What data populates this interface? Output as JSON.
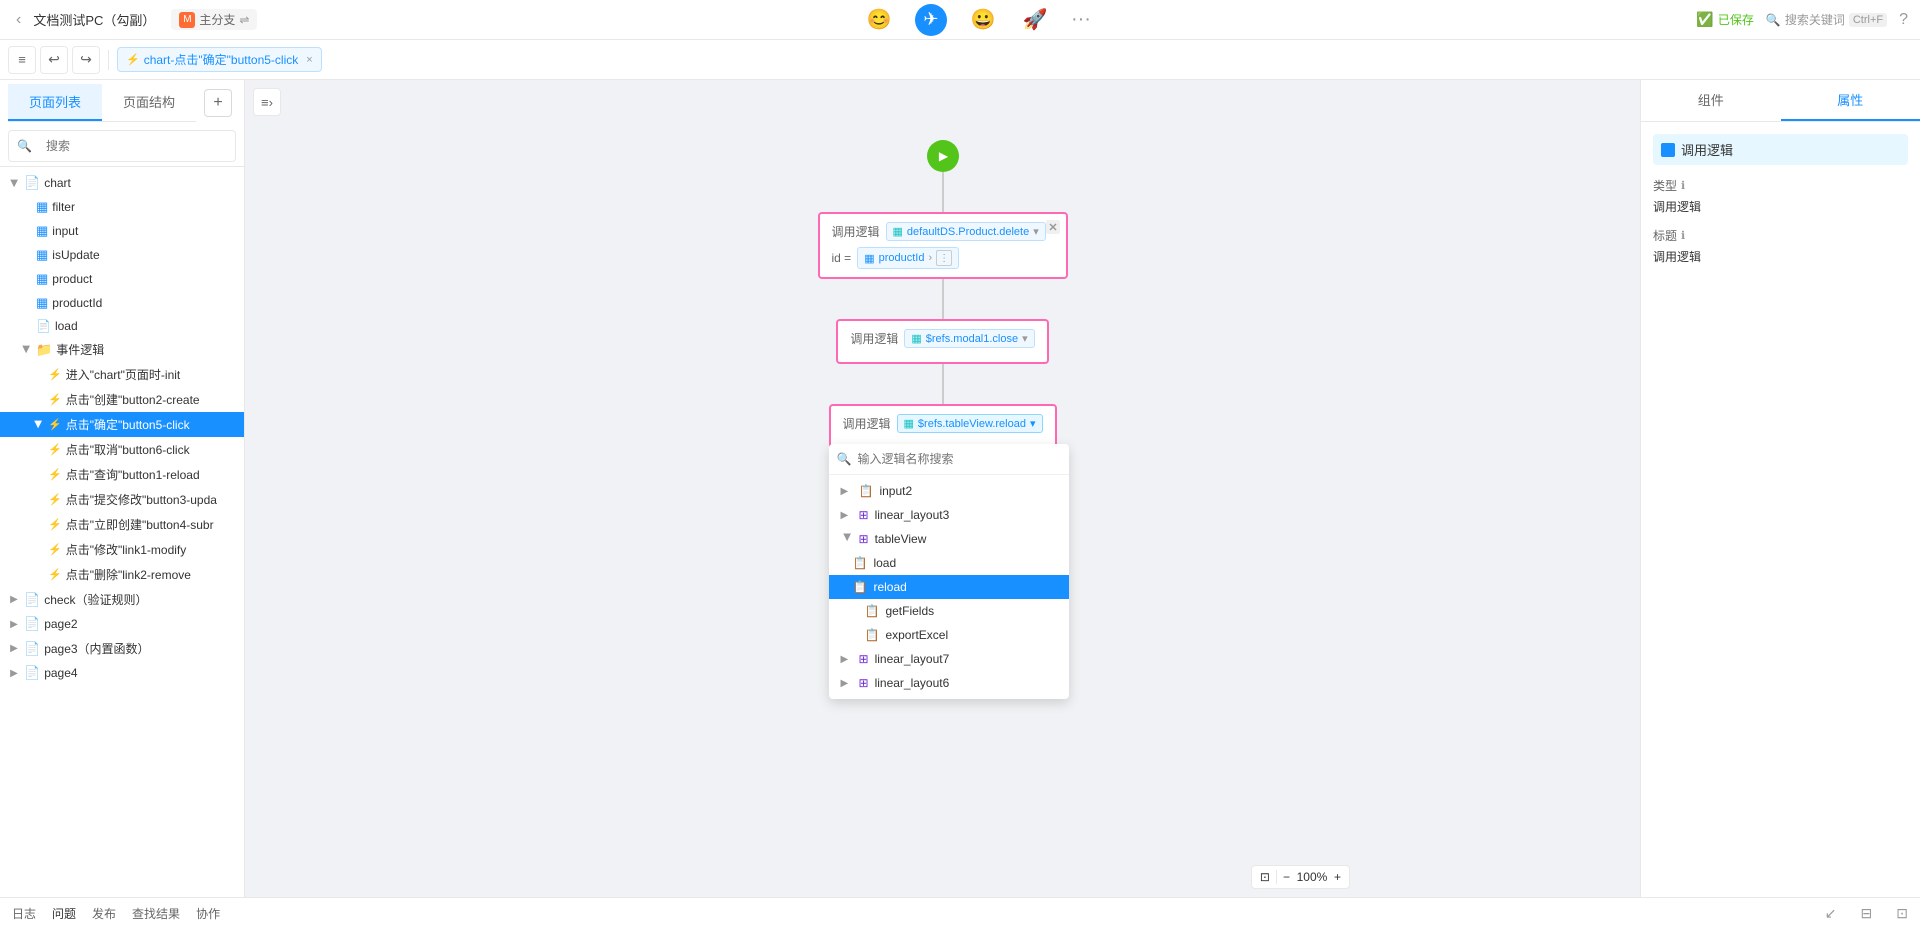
{
  "window": {
    "title": "文档测试PC（勾副）"
  },
  "topbar": {
    "title": "文档测试PC（勾副）",
    "branch_icon": "M",
    "branch_name": "主分支",
    "branch_sync": "⇌",
    "icon1": "😊",
    "icon2": "✈",
    "icon3": "😀",
    "icon4": "🚀",
    "more": "···",
    "saved_icon": "✓",
    "saved_label": "已保存",
    "search_label": "搜索关键词",
    "search_shortcut": "Ctrl+F",
    "help_icon": "?"
  },
  "left_nav": {
    "tab_page_list": "页面列表",
    "tab_page_structure": "页面结构",
    "add_btn": "+",
    "search_placeholder": "搜索"
  },
  "toolbar": {
    "collapse_icon": "≡",
    "undo_icon": "↩",
    "redo_icon": "↪",
    "tab_label": "chart-点击\"确定\"button5-click",
    "tab_close": "×"
  },
  "tree": {
    "items": [
      {
        "id": "chart",
        "level": 1,
        "label": "chart",
        "icon": "📄",
        "icon_color": "green",
        "expanded": true,
        "arrow": "▶"
      },
      {
        "id": "filter",
        "level": 2,
        "label": "filter",
        "icon": "▦",
        "icon_color": "blue"
      },
      {
        "id": "input",
        "level": 2,
        "label": "input",
        "icon": "▦",
        "icon_color": "blue"
      },
      {
        "id": "isUpdate",
        "level": 2,
        "label": "isUpdate",
        "icon": "▦",
        "icon_color": "blue"
      },
      {
        "id": "product",
        "level": 2,
        "label": "product",
        "icon": "▦",
        "icon_color": "blue"
      },
      {
        "id": "productId",
        "level": 2,
        "label": "productId",
        "icon": "▦",
        "icon_color": "blue"
      },
      {
        "id": "load",
        "level": 2,
        "label": "load",
        "icon": "📄",
        "icon_color": "teal"
      },
      {
        "id": "events",
        "level": 2,
        "label": "事件逻辑",
        "icon": "📁",
        "icon_color": "orange",
        "expanded": true,
        "arrow": "▶"
      },
      {
        "id": "init",
        "level": 3,
        "label": "进入\"chart\"页面时-init",
        "icon": "⚡",
        "icon_color": "pink"
      },
      {
        "id": "create",
        "level": 3,
        "label": "点击\"创建\"button2-create",
        "icon": "⚡",
        "icon_color": "pink"
      },
      {
        "id": "confirm",
        "level": 3,
        "label": "点击\"确定\"button5-click",
        "icon": "⚡",
        "icon_color": "pink",
        "active": true
      },
      {
        "id": "cancel",
        "level": 3,
        "label": "点击\"取消\"button6-click",
        "icon": "⚡",
        "icon_color": "pink"
      },
      {
        "id": "query",
        "level": 3,
        "label": "点击\"查询\"button1-reload",
        "icon": "⚡",
        "icon_color": "pink"
      },
      {
        "id": "submit",
        "level": 3,
        "label": "点击\"提交修改\"button3-upda",
        "icon": "⚡",
        "icon_color": "pink"
      },
      {
        "id": "instant_create",
        "level": 3,
        "label": "点击\"立即创建\"button4-subr",
        "icon": "⚡",
        "icon_color": "pink"
      },
      {
        "id": "modify",
        "level": 3,
        "label": "点击\"修改\"link1-modify",
        "icon": "⚡",
        "icon_color": "pink"
      },
      {
        "id": "remove",
        "level": 3,
        "label": "点击\"删除\"link2-remove",
        "icon": "⚡",
        "icon_color": "pink"
      },
      {
        "id": "check",
        "level": 1,
        "label": "check（验证规则）",
        "icon": "📄",
        "icon_color": "green"
      },
      {
        "id": "page2",
        "level": 1,
        "label": "page2",
        "icon": "📄",
        "icon_color": "green"
      },
      {
        "id": "page3",
        "level": 1,
        "label": "page3（内置函数）",
        "icon": "📄",
        "icon_color": "green"
      },
      {
        "id": "page4",
        "level": 1,
        "label": "page4",
        "icon": "📄",
        "icon_color": "green"
      }
    ]
  },
  "flow": {
    "start_title": "开始",
    "node1": {
      "label": "调用逻辑",
      "func": "defaultDS.Product.delete",
      "param_label": "id =",
      "param_value": "productId",
      "has_more": true
    },
    "node2": {
      "label": "调用逻辑",
      "func": "$refs.modal1.close"
    },
    "node3": {
      "label": "调用逻辑",
      "func": "$refs.tableView.reload"
    }
  },
  "dropdown": {
    "search_placeholder": "输入逻辑名称搜索",
    "items": [
      {
        "id": "input2",
        "label": "input2",
        "level": 1,
        "icon": "📋",
        "has_arrow": true
      },
      {
        "id": "linear_layout3",
        "label": "linear_layout3",
        "level": 1,
        "icon": "⊞",
        "has_arrow": true
      },
      {
        "id": "tableView",
        "label": "tableView",
        "level": 1,
        "icon": "⊞",
        "has_arrow": true,
        "expanded": true
      },
      {
        "id": "load",
        "label": "load",
        "level": 2,
        "icon": "📋"
      },
      {
        "id": "reload",
        "label": "reload",
        "level": 2,
        "icon": "📋",
        "active": true
      },
      {
        "id": "getFields",
        "label": "getFields",
        "level": 3,
        "icon": "📋"
      },
      {
        "id": "exportExcel",
        "label": "exportExcel",
        "level": 3,
        "icon": "📋"
      },
      {
        "id": "linear_layout7",
        "label": "linear_layout7",
        "level": 1,
        "icon": "⊞",
        "has_arrow": true
      },
      {
        "id": "linear_layout6",
        "label": "linear_layout6",
        "level": 1,
        "icon": "⊞",
        "has_arrow": true
      }
    ]
  },
  "right_panel": {
    "tab_component": "组件",
    "tab_properties": "属性",
    "section_title": "调用逻辑",
    "field_type_label": "类型",
    "field_type_info": "ℹ",
    "field_type_value": "调用逻辑",
    "field_label_label": "标题",
    "field_label_info": "ℹ",
    "field_label_value": "调用逻辑"
  },
  "bottom_bar": {
    "tab_log": "日志",
    "tab_issues": "问题",
    "tab_publish": "发布",
    "tab_find": "查找结果",
    "tab_collab": "协作"
  },
  "zoom": {
    "fit_icon": "⊡",
    "minus_icon": "−",
    "value": "100%",
    "plus_icon": "+"
  }
}
